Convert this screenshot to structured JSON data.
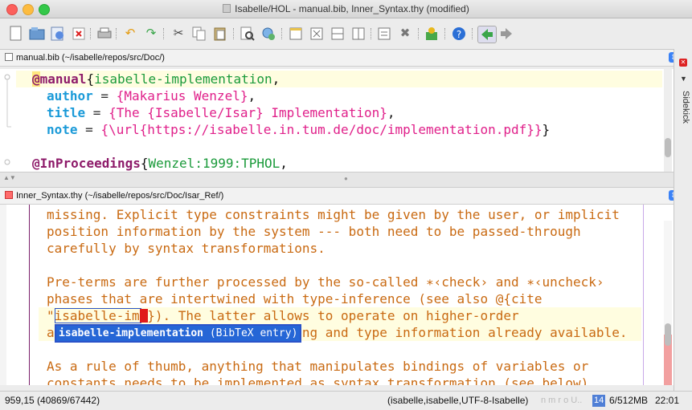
{
  "window": {
    "title": "Isabelle/HOL - manual.bib, Inner_Syntax.thy (modified)"
  },
  "toolbar": {
    "icons": [
      "new-file-icon",
      "open-file-icon",
      "reload-icon",
      "close-file-icon",
      "print-icon",
      "undo-icon",
      "redo-icon",
      "cut-icon",
      "copy-icon",
      "paste-icon",
      "find-icon",
      "replace-icon",
      "new-view-icon",
      "unsplit-icon",
      "split-horizontal-icon",
      "split-vertical-icon",
      "buffer-options-icon",
      "global-options-icon",
      "plugin-manager-icon",
      "help-icon",
      "back-icon",
      "forward-icon"
    ]
  },
  "buffer1": {
    "header": "manual.bib (~/isabelle/repos/src/Doc/)",
    "lines": [
      {
        "at": "@",
        "kw": "manual",
        "brace": "{",
        "key": "isabelle-implementation",
        "comma": ","
      },
      {
        "field": "author",
        "eq": " = ",
        "val": "{Makarius Wenzel}",
        "end": ","
      },
      {
        "field": "title",
        "eq": " = ",
        "val": "{The {Isabelle/Isar} Implementation}",
        "end": ","
      },
      {
        "field": "note",
        "eq": " = ",
        "val": "{\\url{https://isabelle.in.tum.de/doc/implementation.pdf}}",
        "end": "}"
      },
      {
        "at": "@",
        "kw": "InProceedings",
        "brace": "{",
        "key": "Wenzel:1999:TPHOL",
        "comma": ","
      }
    ]
  },
  "buffer2": {
    "header": "Inner_Syntax.thy (~/isabelle/repos/src/Doc/Isar_Ref/)",
    "lines": [
      "missing. Explicit type constraints might be given by the user, or implicit",
      "position information by the system --- both need to be passed-through",
      "carefully by syntax transformations.",
      "",
      "Pre-terms are further processed by the so-called ∗‹check› and ∗‹uncheck›",
      "phases that are intertwined with type-inference (see also @{cite",
      "\"isabelle-im\"}). The latter allows to operate on higher-order",
      "abstract syntax with proper binding and type information already available.",
      "",
      "As a rule of thumb, anything that manipulates bindings of variables or",
      "constants needs to be implemented as syntax transformation (see below)."
    ]
  },
  "completion": {
    "item": "isabelle-implementation",
    "kind": "(BibTeX entry)"
  },
  "sidebar": {
    "label": "Sidekick"
  },
  "status": {
    "position": "959,15 (40869/67442)",
    "mode": "(isabelle,isabelle,UTF-8-Isabelle)",
    "flags": "n m r o U..",
    "memory_used": "14",
    "memory_rest": "6/512MB",
    "time": "22:01"
  },
  "colors": {
    "memory_bar": "#4f7fd6",
    "error_marker": "#f2a0a0"
  }
}
